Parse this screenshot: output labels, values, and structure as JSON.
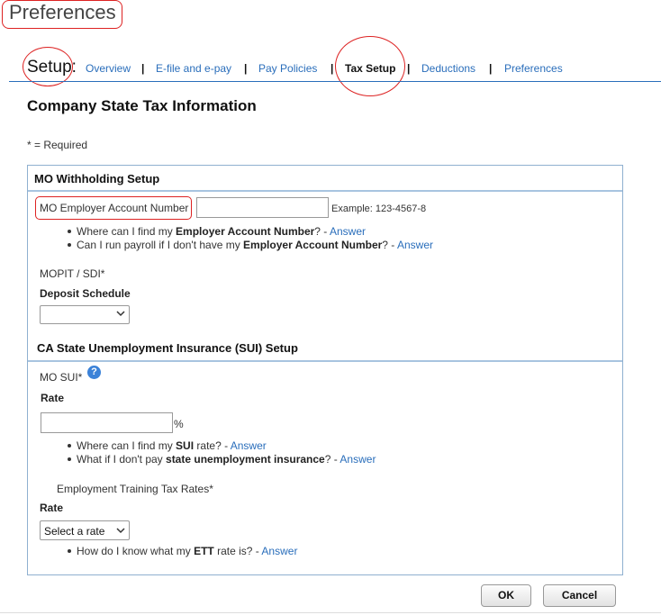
{
  "page_title": "Preferences",
  "nav": {
    "setup_label": "Setup:",
    "items": [
      {
        "label": "Overview"
      },
      {
        "label": "E-file and e-pay"
      },
      {
        "label": "Pay Policies"
      },
      {
        "label": "Tax Setup"
      },
      {
        "label": "Deductions"
      },
      {
        "label": "Preferences"
      }
    ],
    "separator": "|"
  },
  "heading": "Company State Tax Information",
  "required_note": "* = Required",
  "withholding": {
    "title": "MO Withholding Setup",
    "account_label": "MO Employer Account Number",
    "account_value": "",
    "account_example": "Example: 123-4567-8",
    "faq": [
      {
        "pre": "Where can I find my ",
        "bold": "Employer Account Number",
        "post": "? - ",
        "link": "Answer"
      },
      {
        "pre": "Can I run payroll if I don't have my ",
        "bold": "Employer Account Number",
        "post": "? - ",
        "link": "Answer"
      }
    ],
    "mopit_label": "MOPIT / SDI*",
    "deposit_label": "Deposit Schedule",
    "deposit_value": ""
  },
  "sui": {
    "title": "CA State Unemployment Insurance (SUI) Setup",
    "label": "MO SUI*",
    "help_icon": "?",
    "rate_label": "Rate",
    "rate_value": "",
    "rate_unit": "%",
    "faq": [
      {
        "pre": "Where can I find my ",
        "bold": "SUI",
        "post": " rate? - ",
        "link": "Answer"
      },
      {
        "pre": "What if I don't pay ",
        "bold": "state unemployment insurance",
        "post": "? - ",
        "link": "Answer"
      }
    ],
    "ett_label": "Employment Training Tax Rates*",
    "ett_rate_label": "Rate",
    "ett_rate_value": "Select a rate",
    "ett_faq": {
      "pre": "How do I know what my ",
      "bold": "ETT",
      "post": " rate is? - ",
      "link": "Answer"
    }
  },
  "buttons": {
    "ok": "OK",
    "cancel": "Cancel"
  },
  "colors": {
    "link": "#2a6ebb",
    "annotation": "#dd2222",
    "panel_border": "#8fb0d0"
  }
}
